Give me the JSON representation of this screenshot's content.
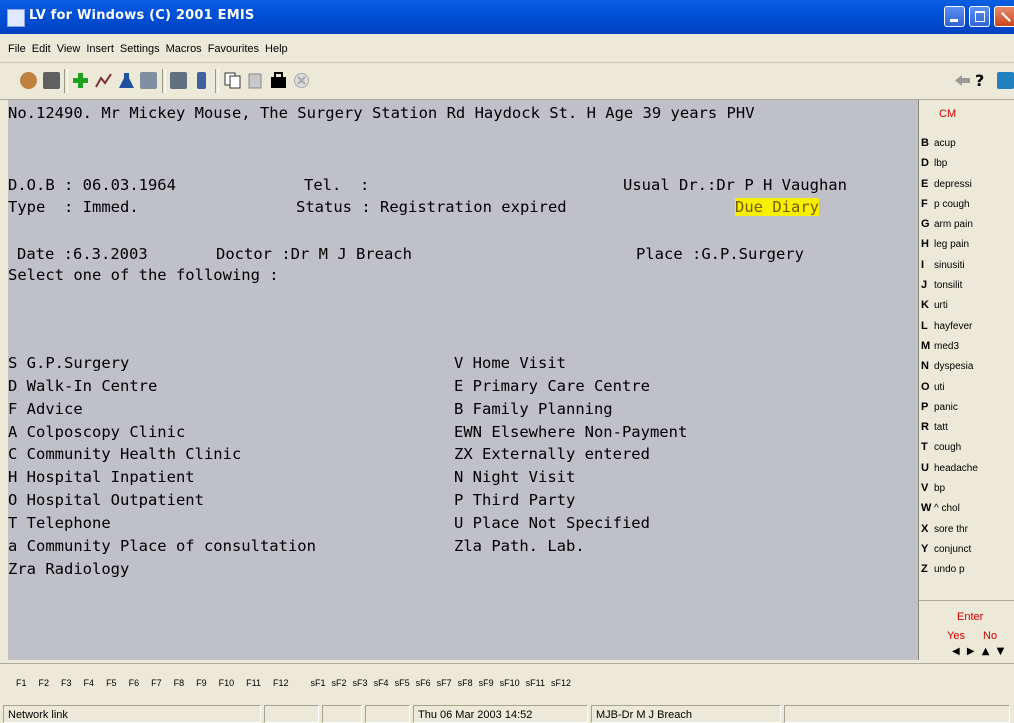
{
  "window": {
    "title": "LV for Windows (C) 2001 EMIS"
  },
  "menu": [
    "File",
    "Edit",
    "View",
    "Insert",
    "Settings",
    "Macros",
    "Favourites",
    "Help"
  ],
  "toolbar_icons": [
    "patient-icon",
    "lock-icon",
    "add-icon",
    "chart-icon",
    "flask-icon",
    "document-icon",
    "calculator-icon",
    "phone-icon",
    "copy-icon",
    "paste-icon",
    "bag-icon",
    "cancel-icon",
    "back-arrow-icon",
    "help-icon",
    "monitor-icon"
  ],
  "patient": {
    "header": "No.12490. Mr Mickey Mouse, The Surgery Station Rd Haydock St. H Age 39 years PHV",
    "dob": "D.O.B : 06.03.1964",
    "tel": "Tel.  :",
    "usual_dr": "Usual Dr.:Dr P H Vaughan",
    "type": "Type  : Immed.",
    "status": "Status : Registration expired",
    "due_diary": "Due Diary"
  },
  "consultation": {
    "date": "Date :6.3.2003",
    "doctor": "Doctor :Dr M J Breach",
    "place": "Place :G.P.Surgery",
    "prompt": "Select one of the following :"
  },
  "options_left": [
    "S G.P.Surgery",
    "D Walk-In Centre",
    "F Advice",
    "A Colposcopy Clinic",
    "C Community Health Clinic",
    "H Hospital Inpatient",
    "O Hospital Outpatient",
    "T Telephone",
    "a Community Place of consultation",
    "Zra Radiology"
  ],
  "options_right": [
    "V Home Visit",
    "E Primary Care Centre",
    "B Family Planning",
    "EWN Elsewhere Non-Payment",
    "ZX Externally entered",
    "N Night Visit",
    "P Third Party",
    "U Place Not Specified",
    "Zla Path. Lab."
  ],
  "sidebar": {
    "heading": "CM",
    "items": [
      {
        "key": "B",
        "label": "acup"
      },
      {
        "key": "D",
        "label": "lbp"
      },
      {
        "key": "E",
        "label": "depressi"
      },
      {
        "key": "F",
        "label": "p cough"
      },
      {
        "key": "G",
        "label": "arm pain"
      },
      {
        "key": "H",
        "label": "leg pain"
      },
      {
        "key": "I",
        "label": "sinusiti"
      },
      {
        "key": "J",
        "label": "tonsilit"
      },
      {
        "key": "K",
        "label": "urti"
      },
      {
        "key": "L",
        "label": "hayfever"
      },
      {
        "key": "M",
        "label": "med3"
      },
      {
        "key": "N",
        "label": "dyspesia"
      },
      {
        "key": "O",
        "label": "uti"
      },
      {
        "key": "P",
        "label": "panic"
      },
      {
        "key": "R",
        "label": "tatt"
      },
      {
        "key": "T",
        "label": "cough"
      },
      {
        "key": "U",
        "label": "headache"
      },
      {
        "key": "V",
        "label": "bp"
      },
      {
        "key": "W",
        "label": "^ chol"
      },
      {
        "key": "X",
        "label": "sore thr"
      },
      {
        "key": "Y",
        "label": "conjunct"
      },
      {
        "key": "Z",
        "label": "undo p"
      }
    ],
    "enter": "Enter",
    "yes": "Yes",
    "no": "No",
    "arrows": "◀ ▶ ▲ ▼"
  },
  "fkeys": [
    "F1",
    "F2",
    "F3",
    "F4",
    "F5",
    "F6",
    "F7",
    "F8",
    "F9",
    "F10",
    "F11",
    "F12"
  ],
  "sfkeys": [
    "sF1",
    "sF2",
    "sF3",
    "sF4",
    "sF5",
    "sF6",
    "sF7",
    "sF8",
    "sF9",
    "sF10",
    "sF11",
    "sF12"
  ],
  "statusbar": {
    "network": "Network link",
    "datetime": "Thu 06 Mar 2003 14:52",
    "user": "MJB-Dr M J Breach"
  }
}
